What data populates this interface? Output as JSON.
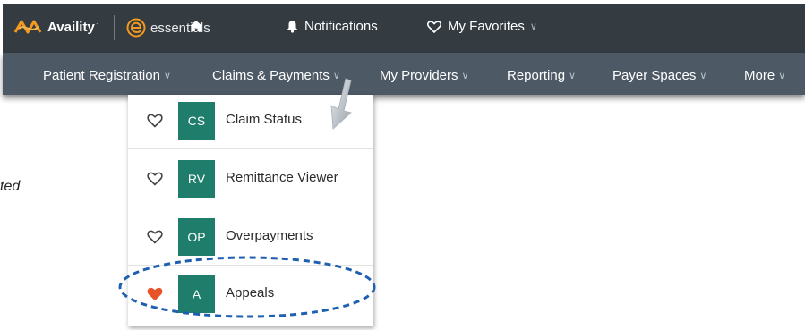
{
  "topbar": {
    "brand": "Availity",
    "trademark": "·",
    "essentials_label": "essentials",
    "home_icon": "home-icon",
    "notifications_label": "Notifications",
    "favorites_label": "My Favorites",
    "caret": "∨"
  },
  "nav": {
    "items": [
      {
        "label": "Patient Registration",
        "caret": "∨"
      },
      {
        "label": "Claims & Payments",
        "caret": "∨"
      },
      {
        "label": "My Providers",
        "caret": "∨"
      },
      {
        "label": "Reporting",
        "caret": "∨"
      },
      {
        "label": "Payer Spaces",
        "caret": "∨"
      },
      {
        "label": "More",
        "caret": "∨"
      }
    ]
  },
  "dropdown": {
    "items": [
      {
        "badge": "CS",
        "label": "Claim Status",
        "favorited": false
      },
      {
        "badge": "RV",
        "label": "Remittance Viewer",
        "favorited": false
      },
      {
        "badge": "OP",
        "label": "Overpayments",
        "favorited": false
      },
      {
        "badge": "A",
        "label": "Appeals",
        "favorited": true
      }
    ]
  },
  "side_note": "ted",
  "colors": {
    "topbar_bg": "#343b41",
    "navbar_bg": "#4d5a65",
    "badge_green": "#1f7e6b",
    "heart_active": "#e8542a",
    "logo_orange": "#f39a1e",
    "highlight_blue": "#1f5fb0"
  }
}
